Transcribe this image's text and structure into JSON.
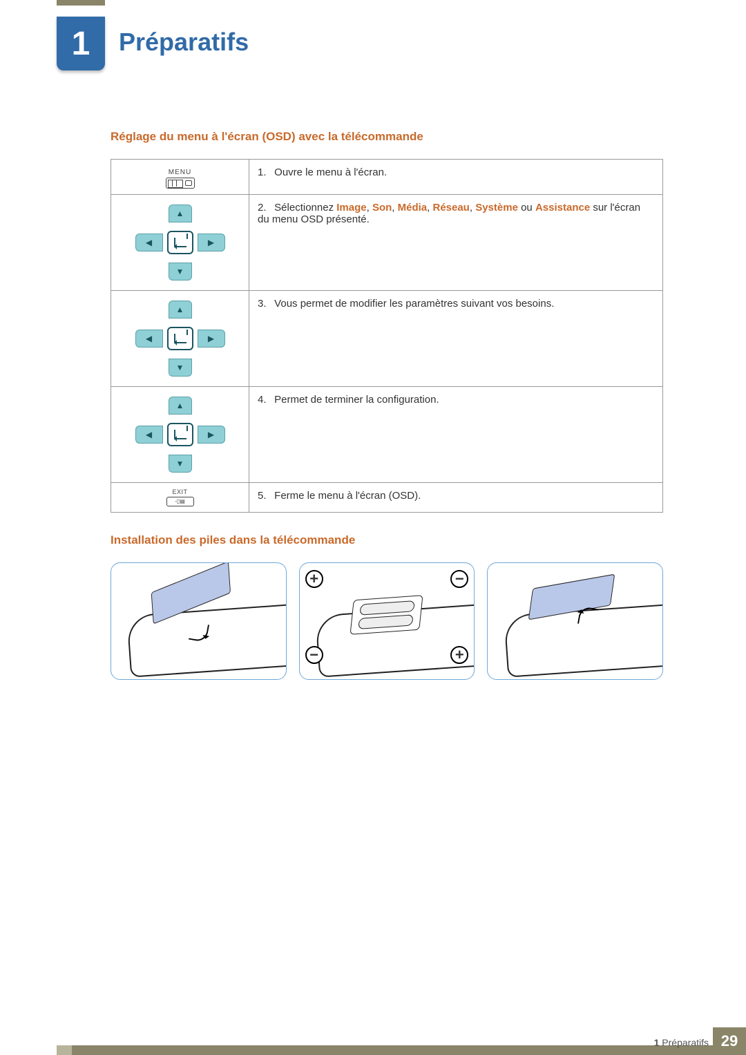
{
  "chapter": {
    "number": "1",
    "title": "Préparatifs"
  },
  "section1": {
    "heading": "Réglage du menu à l'écran (OSD) avec la télécommande",
    "rows": [
      {
        "button_label": "MENU",
        "step_num": "1.",
        "text": "Ouvre le menu à l'écran."
      },
      {
        "step_num": "2.",
        "text_prefix": "Sélectionnez ",
        "opts": [
          "Image",
          "Son",
          "Média",
          "Réseau",
          "Système"
        ],
        "or_word": " ou ",
        "opt_last": "Assistance",
        "text_suffix": " sur l'écran du menu OSD présenté.",
        "sep": ", "
      },
      {
        "step_num": "3.",
        "text": "Vous permet de modifier les paramètres suivant vos besoins."
      },
      {
        "step_num": "4.",
        "text": "Permet de terminer la configuration."
      },
      {
        "button_label": "EXIT",
        "step_num": "5.",
        "text": "Ferme le menu à l'écran (OSD)."
      }
    ]
  },
  "section2": {
    "heading": "Installation des piles dans la télécommande",
    "polarity": {
      "plus": "+",
      "minus": "−"
    }
  },
  "footer": {
    "crumb_num": "1",
    "crumb_text": "Préparatifs",
    "page": "29"
  }
}
